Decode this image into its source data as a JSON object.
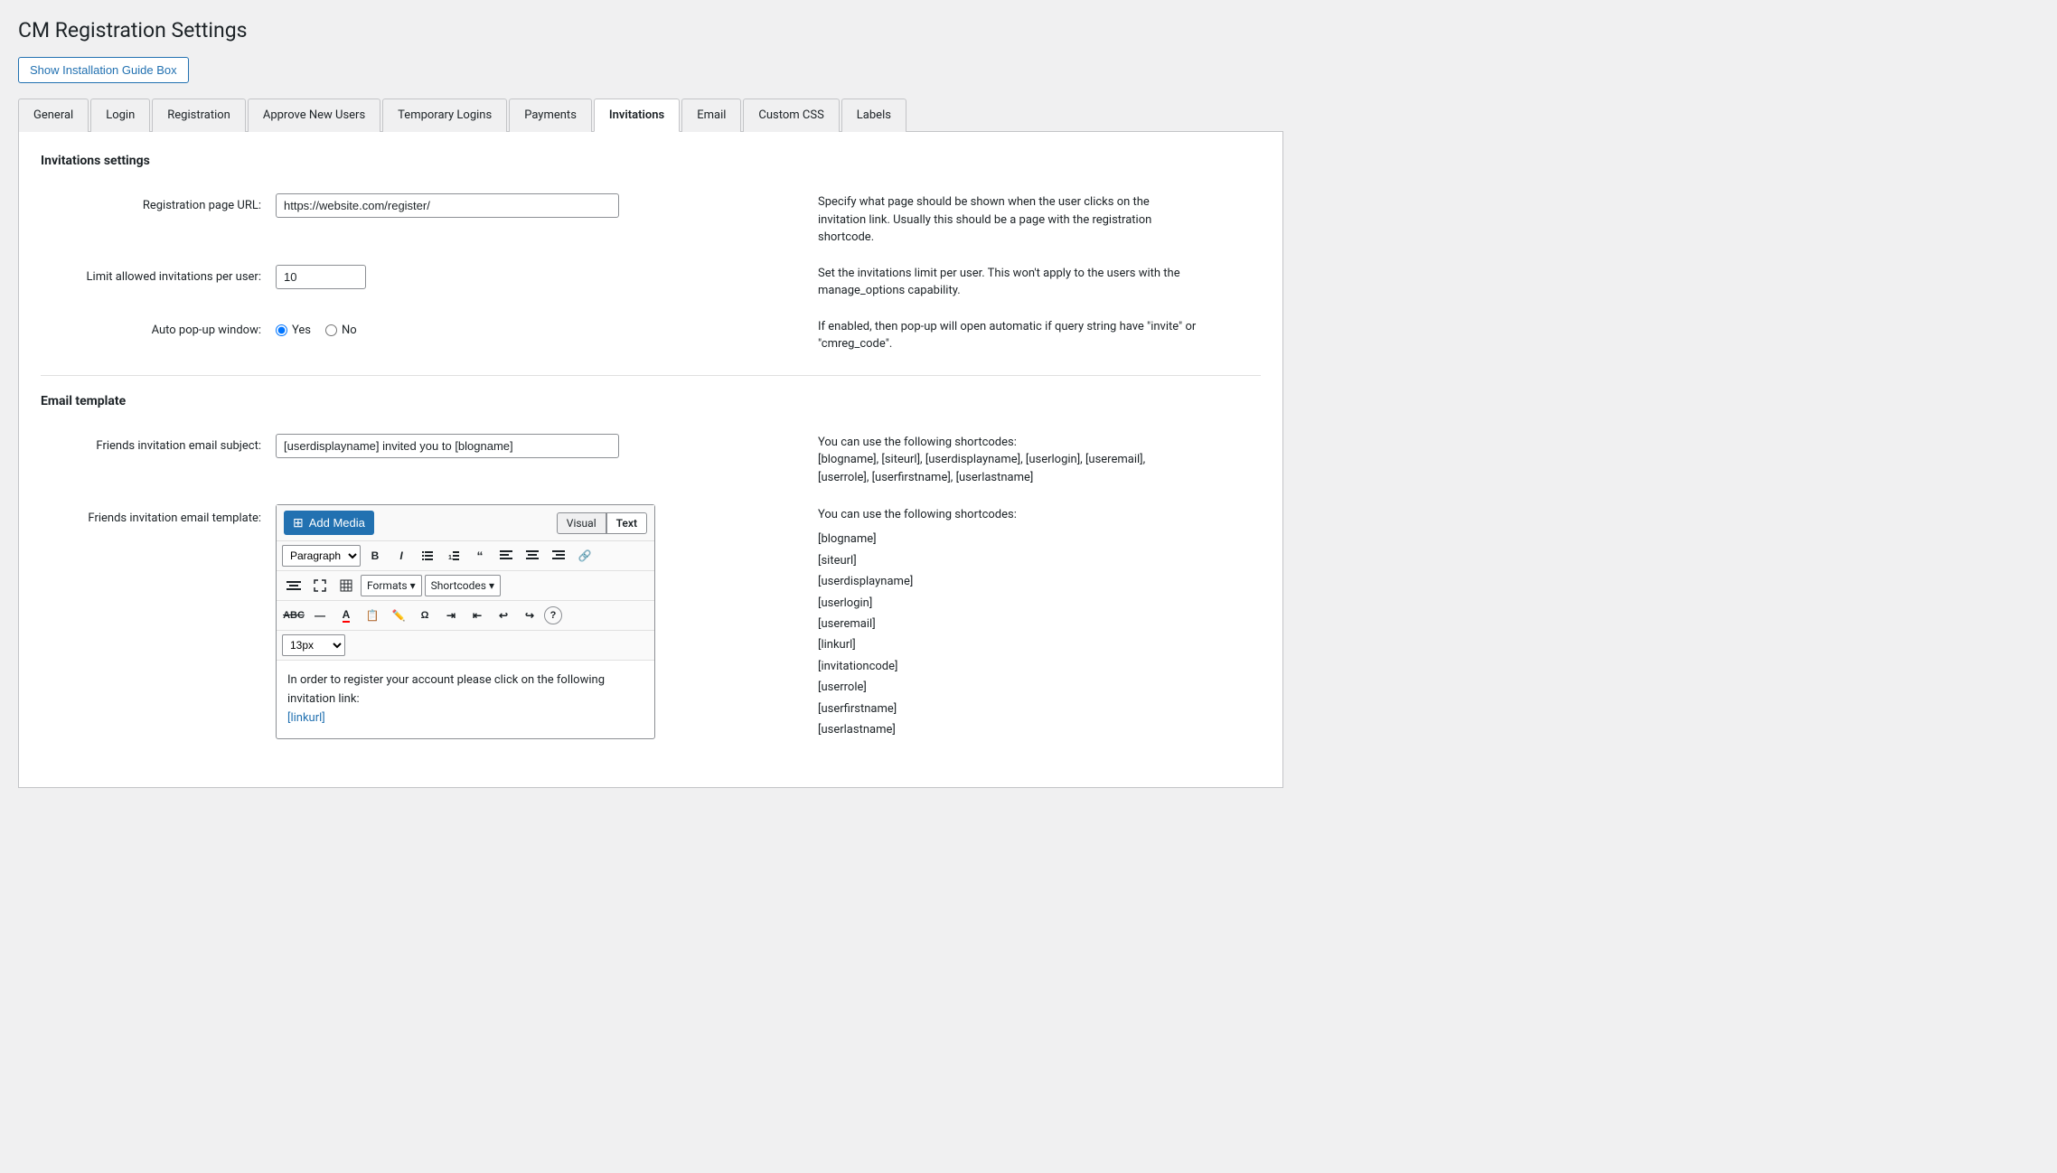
{
  "page": {
    "title": "CM Registration Settings"
  },
  "install_guide_btn": "Show Installation Guide Box",
  "tabs": [
    {
      "id": "general",
      "label": "General",
      "active": false
    },
    {
      "id": "login",
      "label": "Login",
      "active": false
    },
    {
      "id": "registration",
      "label": "Registration",
      "active": false
    },
    {
      "id": "approve-new-users",
      "label": "Approve New Users",
      "active": false
    },
    {
      "id": "temporary-logins",
      "label": "Temporary Logins",
      "active": false
    },
    {
      "id": "payments",
      "label": "Payments",
      "active": false
    },
    {
      "id": "invitations",
      "label": "Invitations",
      "active": true
    },
    {
      "id": "email",
      "label": "Email",
      "active": false
    },
    {
      "id": "custom-css",
      "label": "Custom CSS",
      "active": false
    },
    {
      "id": "labels",
      "label": "Labels",
      "active": false
    }
  ],
  "invitations_section": {
    "title": "Invitations settings",
    "fields": {
      "reg_page_url": {
        "label": "Registration page URL:",
        "value": "https://website.com/register/",
        "help": "Specify what page should be shown when the user clicks on the invitation link. Usually this should be a page with the registration shortcode."
      },
      "limit_invitations": {
        "label": "Limit allowed invitations per user:",
        "value": "10",
        "help": "Set the invitations limit per user. This won't apply to the users with the manage_options capability."
      },
      "auto_popup": {
        "label": "Auto pop-up window:",
        "yes_label": "Yes",
        "no_label": "No",
        "help": "If enabled, then pop-up will open automatic if query string have \"invite\" or \"cmreg_code\"."
      }
    }
  },
  "email_section": {
    "title": "Email template",
    "fields": {
      "subject": {
        "label": "Friends invitation email subject:",
        "value": "[userdisplayname] invited you to [blogname]",
        "help_label": "You can use the following shortcodes:",
        "help_codes": "[blogname], [siteurl], [userdisplayname], [userlogin], [useremail], [userrole], [userfirstname], [userlastname]"
      },
      "template": {
        "label": "Friends invitation email template:",
        "view_visual": "Visual",
        "view_text": "Text",
        "add_media": "Add Media",
        "toolbar": {
          "format_select": "Paragraph",
          "bold": "B",
          "italic": "I",
          "unordered_list": "≡",
          "ordered_list": "≡",
          "blockquote": "❝",
          "align_left": "≡",
          "align_center": "≡",
          "align_right": "≡",
          "link": "🔗",
          "formats_label": "Formats",
          "shortcodes_label": "Shortcodes",
          "fontsize": "13px"
        },
        "body_text": "In order to register your account please click on the following invitation link:",
        "body_link": "[linkurl]",
        "help_label": "You can use the following shortcodes:",
        "help_codes": [
          "[blogname]",
          "[siteurl]",
          "[userdisplayname]",
          "[userlogin]",
          "[useremail]",
          "[linkurl]",
          "[invitationcode]",
          "[userrole]",
          "[userfirstname]",
          "[userlastname]"
        ]
      }
    }
  }
}
